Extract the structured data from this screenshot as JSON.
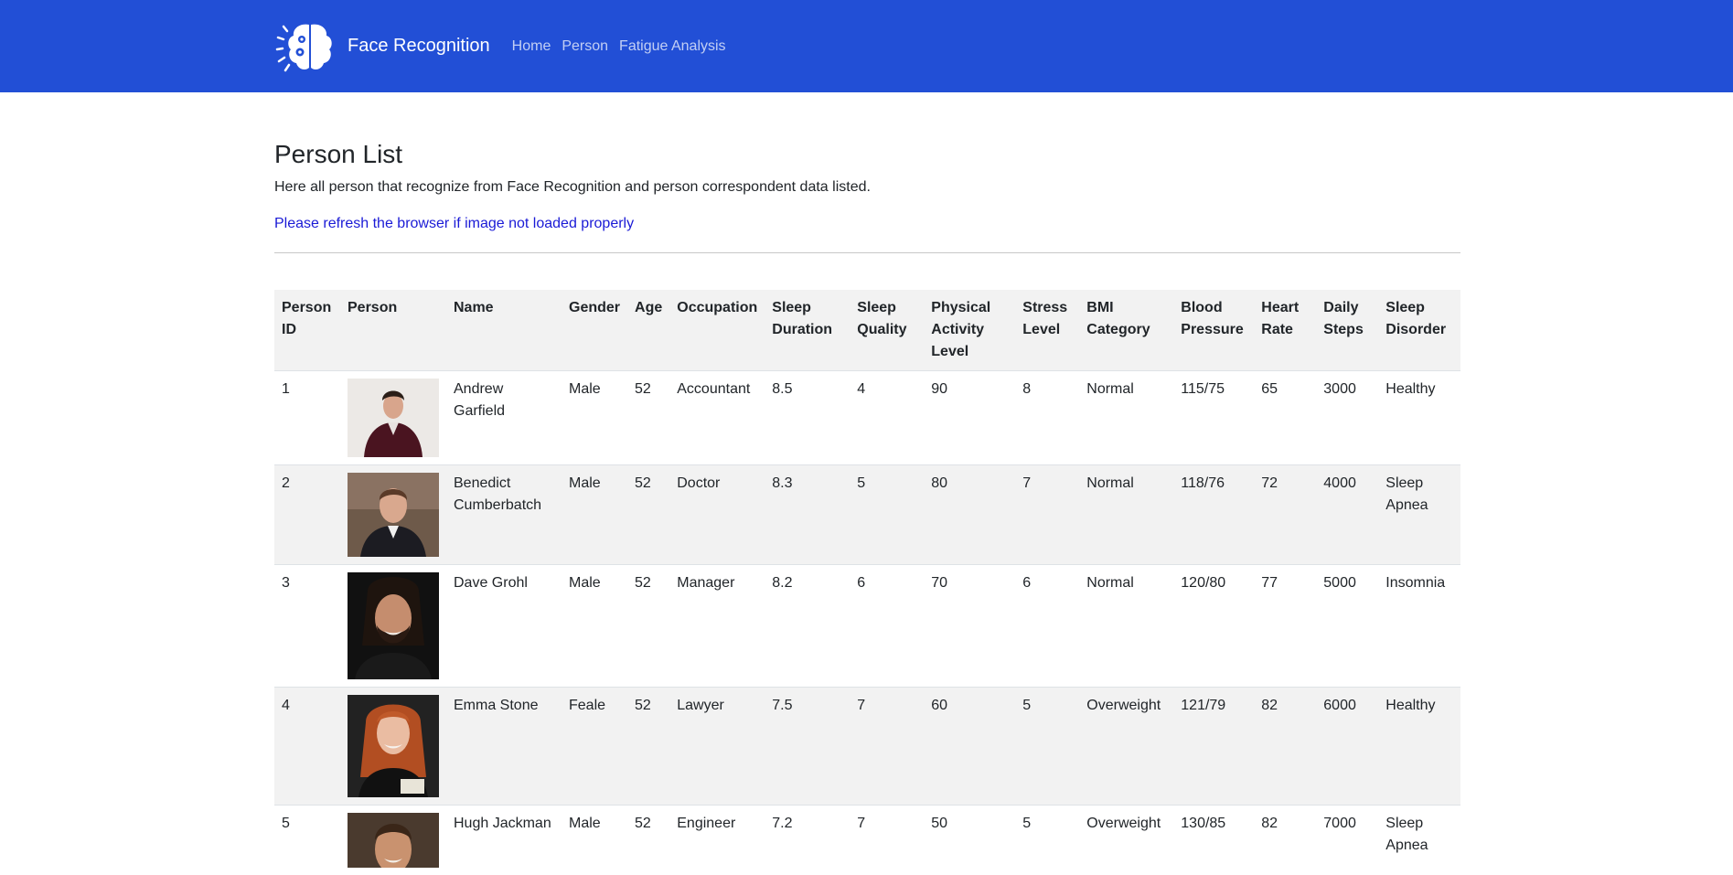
{
  "nav": {
    "brand": "Face Recognition",
    "links": [
      {
        "label": "Home"
      },
      {
        "label": "Person"
      },
      {
        "label": "Fatigue Analysis"
      }
    ]
  },
  "page": {
    "title": "Person List",
    "description": "Here all person that recognize from Face Recognition and person correspondent data listed.",
    "refresh_note": "Please refresh the browser if image not loaded properly"
  },
  "table": {
    "headers": [
      "Person ID",
      "Person",
      "Name",
      "Gender",
      "Age",
      "Occupation",
      "Sleep Duration",
      "Sleep Quality",
      "Physical Activity Level",
      "Stress Level",
      "BMI Category",
      "Blood Pressure",
      "Heart Rate",
      "Daily Steps",
      "Sleep Disorder"
    ],
    "rows": [
      {
        "id": "1",
        "name": "Andrew Garfield",
        "gender": "Male",
        "age": "52",
        "occupation": "Accountant",
        "sleep_duration": "8.5",
        "sleep_quality": "4",
        "activity": "90",
        "stress": "8",
        "bmi": "Normal",
        "bp": "115/75",
        "heart_rate": "65",
        "steps": "3000",
        "disorder": "Healthy"
      },
      {
        "id": "2",
        "name": "Benedict Cumberbatch",
        "gender": "Male",
        "age": "52",
        "occupation": "Doctor",
        "sleep_duration": "8.3",
        "sleep_quality": "5",
        "activity": "80",
        "stress": "7",
        "bmi": "Normal",
        "bp": "118/76",
        "heart_rate": "72",
        "steps": "4000",
        "disorder": "Sleep Apnea"
      },
      {
        "id": "3",
        "name": "Dave Grohl",
        "gender": "Male",
        "age": "52",
        "occupation": "Manager",
        "sleep_duration": "8.2",
        "sleep_quality": "6",
        "activity": "70",
        "stress": "6",
        "bmi": "Normal",
        "bp": "120/80",
        "heart_rate": "77",
        "steps": "5000",
        "disorder": "Insomnia"
      },
      {
        "id": "4",
        "name": "Emma Stone",
        "gender": "Feale",
        "age": "52",
        "occupation": "Lawyer",
        "sleep_duration": "7.5",
        "sleep_quality": "7",
        "activity": "60",
        "stress": "5",
        "bmi": "Overweight",
        "bp": "121/79",
        "heart_rate": "82",
        "steps": "6000",
        "disorder": "Healthy"
      },
      {
        "id": "5",
        "name": "Hugh Jackman",
        "gender": "Male",
        "age": "52",
        "occupation": "Engineer",
        "sleep_duration": "7.2",
        "sleep_quality": "7",
        "activity": "50",
        "stress": "5",
        "bmi": "Overweight",
        "bp": "130/85",
        "heart_rate": "82",
        "steps": "7000",
        "disorder": "Sleep Apnea"
      }
    ]
  },
  "colors": {
    "navbar": "#224fd6",
    "link": "#1a1ad6",
    "stripe": "#f2f2f2"
  }
}
